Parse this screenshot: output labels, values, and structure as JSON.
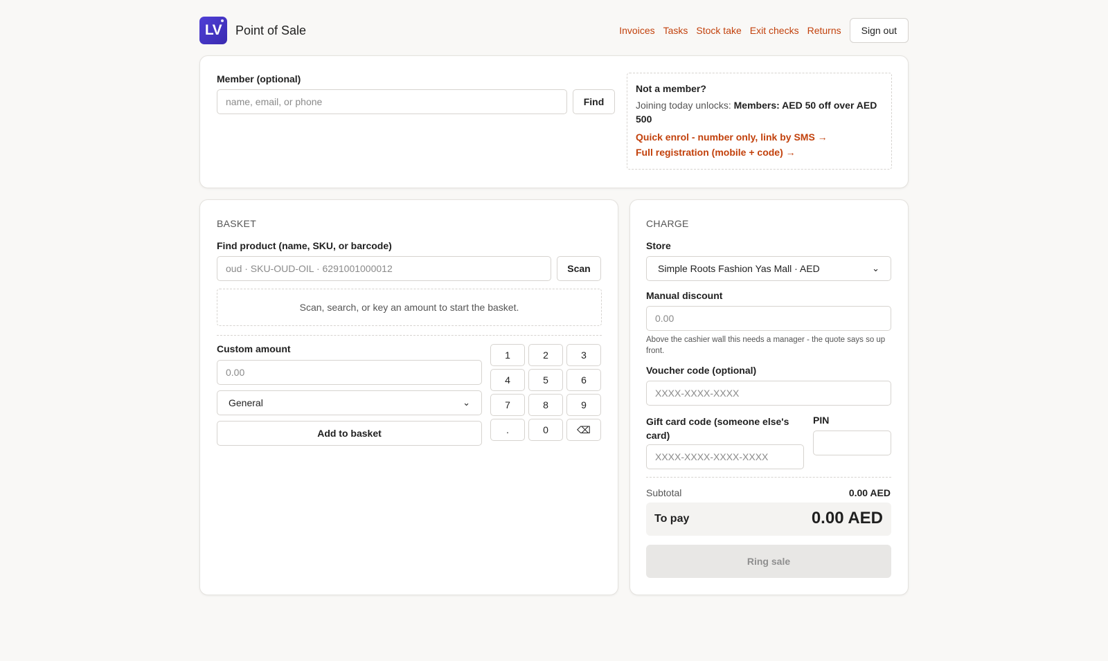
{
  "app": {
    "logo_text": "LV",
    "title": "Point of Sale"
  },
  "nav": {
    "links": [
      "Invoices",
      "Tasks",
      "Stock take",
      "Exit checks",
      "Returns"
    ],
    "sign_out": "Sign out"
  },
  "member": {
    "label": "Member (optional)",
    "placeholder": "name, email, or phone",
    "find_button": "Find",
    "promo": {
      "title": "Not a member?",
      "text_prefix": "Joining today unlocks: ",
      "text_offer": "Members: AED 50 off over AED 500",
      "quick_enrol": "Quick enrol - number only, link by SMS →",
      "full_registration": "Full registration (mobile + code) →"
    }
  },
  "basket": {
    "section_title": "BASKET",
    "find_label": "Find product (name, SKU, or barcode)",
    "find_placeholder": "oud · SKU-OUD-OIL · 6291001000012",
    "scan_button": "Scan",
    "empty_message": "Scan, search, or key an amount to start the basket.",
    "custom_amount_label": "Custom amount",
    "custom_amount_placeholder": "0.00",
    "category_selected": "General",
    "add_button": "Add to basket",
    "keypad": [
      "1",
      "2",
      "3",
      "4",
      "5",
      "6",
      "7",
      "8",
      "9",
      ".",
      "0",
      "⌫"
    ]
  },
  "charge": {
    "section_title": "CHARGE",
    "store_label": "Store",
    "store_selected": "Simple Roots Fashion Yas Mall · AED",
    "discount_label": "Manual discount",
    "discount_placeholder": "0.00",
    "discount_hint": "Above the cashier wall this needs a manager - the quote says so up front.",
    "voucher_label": "Voucher code (optional)",
    "voucher_placeholder": "XXXX-XXXX-XXXX",
    "giftcard_label": "Gift card code (someone else's card)",
    "giftcard_placeholder": "XXXX-XXXX-XXXX-XXXX",
    "pin_label": "PIN",
    "pin_value": "",
    "subtotal_label": "Subtotal",
    "subtotal_value": "0.00 AED",
    "topay_label": "To pay",
    "topay_value": "0.00 AED",
    "ring_button": "Ring sale"
  },
  "colors": {
    "accent": "#c2410c",
    "logo": "#4f3fd6",
    "background": "#f9f8f6"
  },
  "icons": [
    "chevron-down-icon",
    "backspace-icon"
  ]
}
